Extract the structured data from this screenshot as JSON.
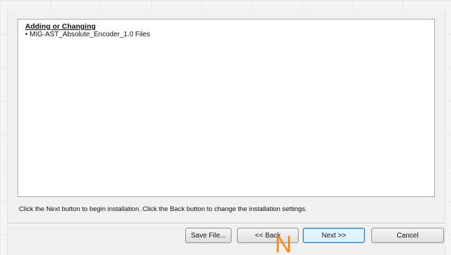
{
  "summary": {
    "heading": "Adding or Changing",
    "items": [
      "• MIG-AST_Absolute_Encoder_1.0 Files"
    ]
  },
  "instructions": "Click the Next button to begin installation.  Click the Back button to change the installation settings.",
  "buttons": {
    "save_file": "Save File...",
    "back": "<< Back",
    "next": "Next >>",
    "cancel": "Cancel"
  },
  "overlay": {
    "glyph": "N",
    "color": "#f28a1c"
  },
  "colors": {
    "dialog_bg": "#f0f0f0",
    "default_button_border": "#3c7fb1"
  }
}
